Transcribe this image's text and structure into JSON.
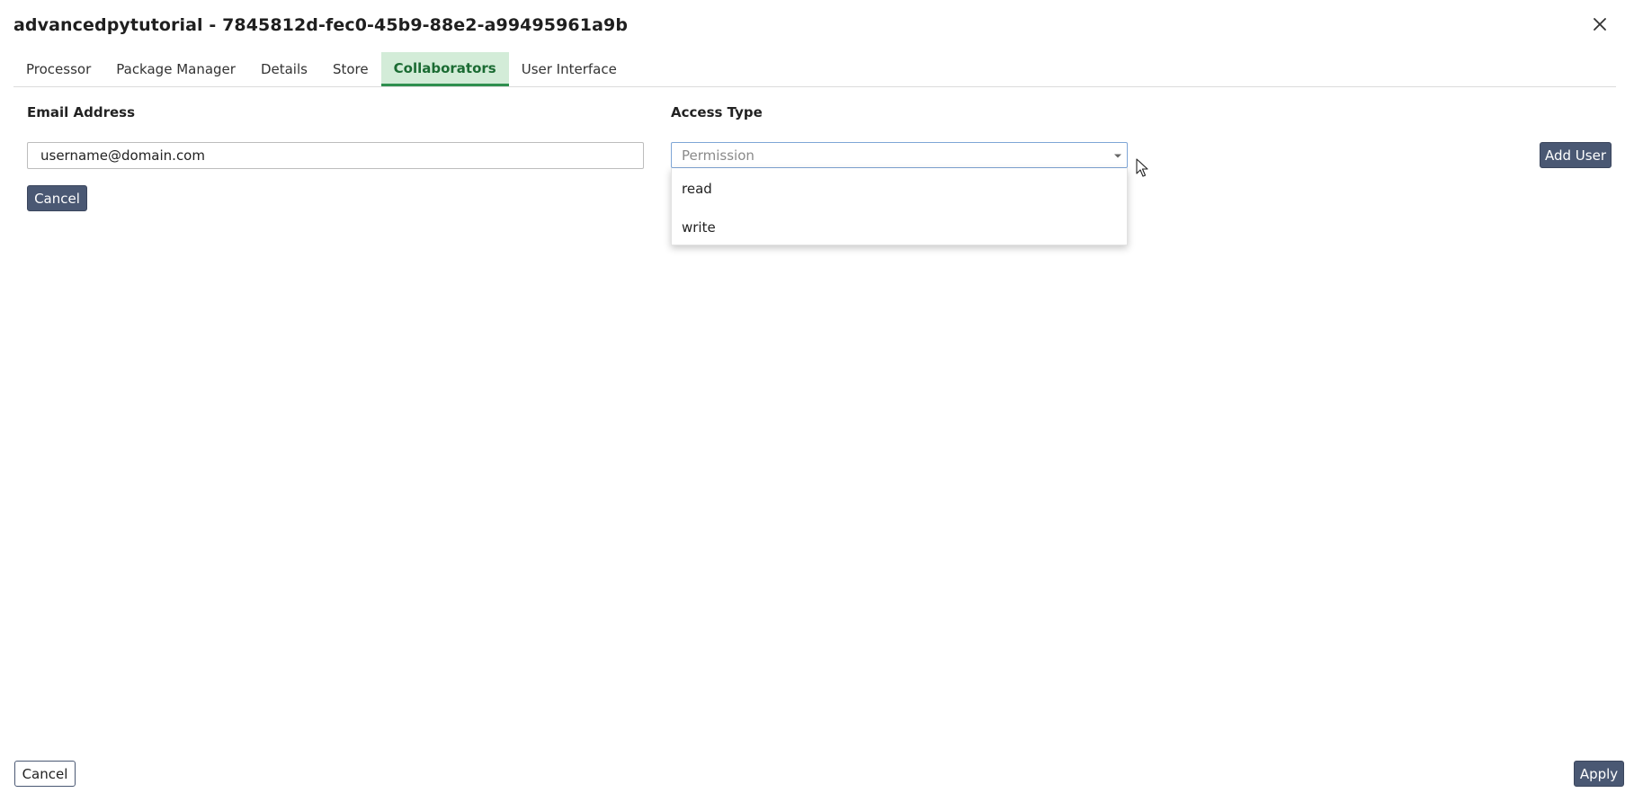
{
  "dialog": {
    "title": "advancedpytutorial - 7845812d-fec0-45b9-88e2-a99495961a9b",
    "close_icon": "close-icon"
  },
  "tabs": [
    {
      "label": "Processor",
      "active": false
    },
    {
      "label": "Package Manager",
      "active": false
    },
    {
      "label": "Details",
      "active": false
    },
    {
      "label": "Store",
      "active": false
    },
    {
      "label": "Collaborators",
      "active": true
    },
    {
      "label": "User Interface",
      "active": false
    }
  ],
  "form": {
    "email_label": "Email Address",
    "email_value": "username@domain.com",
    "access_label": "Access Type",
    "access_placeholder": "Permission",
    "access_caret_icon": "caret-down-icon",
    "access_options": [
      "read",
      "write"
    ],
    "add_user_label": "Add User",
    "cancel_label": "Cancel"
  },
  "footer": {
    "cancel_label": "Cancel",
    "apply_label": "Apply"
  },
  "colors": {
    "button_dark": "#4a5873",
    "tab_active_bg": "#d3ecd8",
    "tab_active_text": "#1b6b33",
    "tab_active_border": "#2f8f4f",
    "select_border": "#7fa6d6"
  }
}
